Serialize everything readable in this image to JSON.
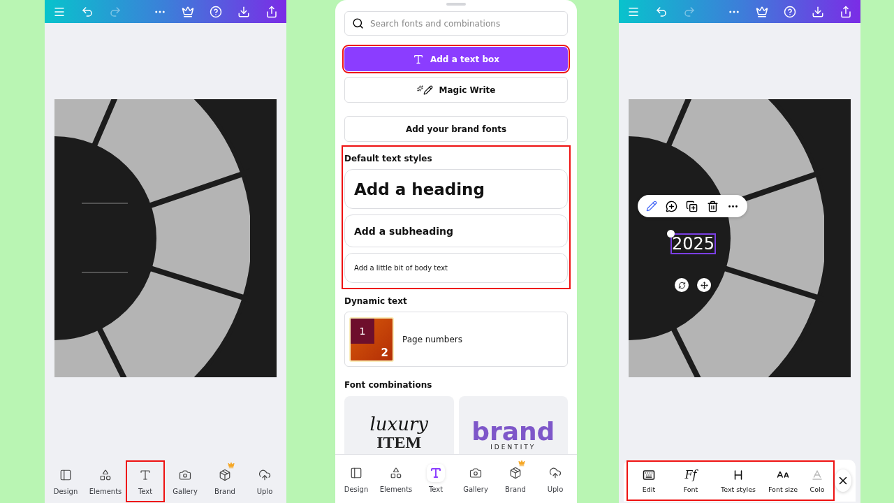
{
  "left_screen": {
    "top_bar": {
      "redo_disabled": true
    },
    "nav": [
      {
        "label": "Design",
        "selected": false,
        "highlighted": false,
        "premium": false
      },
      {
        "label": "Elements",
        "selected": false,
        "highlighted": false,
        "premium": false
      },
      {
        "label": "Text",
        "selected": false,
        "highlighted": true,
        "premium": false
      },
      {
        "label": "Gallery",
        "selected": false,
        "highlighted": false,
        "premium": false
      },
      {
        "label": "Brand",
        "selected": false,
        "highlighted": false,
        "premium": true
      },
      {
        "label": "Uplo",
        "selected": false,
        "highlighted": false,
        "premium": false
      }
    ]
  },
  "middle_screen": {
    "search": {
      "placeholder": "Search fonts and combinations"
    },
    "actions": [
      {
        "label": "Add a text box",
        "kind": "primary",
        "highlighted": true
      },
      {
        "label": "Magic Write",
        "kind": "magic",
        "highlighted": false
      },
      {
        "label": "Add your brand fonts",
        "kind": "plain",
        "highlighted": false
      }
    ],
    "default_styles": {
      "title": "Default text styles",
      "highlighted": true,
      "items": [
        {
          "label": "Add a heading",
          "kind": "heading"
        },
        {
          "label": "Add a subheading",
          "kind": "subheading"
        },
        {
          "label": "Add a little bit of body text",
          "kind": "body"
        }
      ]
    },
    "dynamic_text": {
      "title": "Dynamic text",
      "item": {
        "label": "Page numbers",
        "thumb_first": "1",
        "thumb_second": "2"
      }
    },
    "font_combinations": {
      "title": "Font combinations",
      "items": [
        {
          "kind": "script",
          "lines": [
            "luxury",
            "ITEM"
          ]
        },
        {
          "kind": "brand",
          "lines": [
            "brand",
            "IDENTITY"
          ]
        }
      ]
    },
    "nav": [
      {
        "label": "Design",
        "selected": false,
        "highlighted": false,
        "premium": false
      },
      {
        "label": "Elements",
        "selected": false,
        "highlighted": false,
        "premium": false
      },
      {
        "label": "Text",
        "selected": true,
        "highlighted": false,
        "premium": false
      },
      {
        "label": "Gallery",
        "selected": false,
        "highlighted": false,
        "premium": false
      },
      {
        "label": "Brand",
        "selected": false,
        "highlighted": false,
        "premium": true
      },
      {
        "label": "Uplo",
        "selected": false,
        "highlighted": false,
        "premium": false
      }
    ]
  },
  "right_screen": {
    "top_bar": {
      "redo_disabled": true
    },
    "selected_text": "2025",
    "toolbar": {
      "highlighted": true,
      "tools": [
        {
          "label": "Edit",
          "kind": "keyboard"
        },
        {
          "label": "Font",
          "kind": "glyph",
          "glyph": "Ff"
        },
        {
          "label": "Text styles",
          "kind": "heading"
        },
        {
          "label": "Font size",
          "kind": "size"
        },
        {
          "label": "Colo",
          "kind": "color"
        }
      ]
    }
  }
}
